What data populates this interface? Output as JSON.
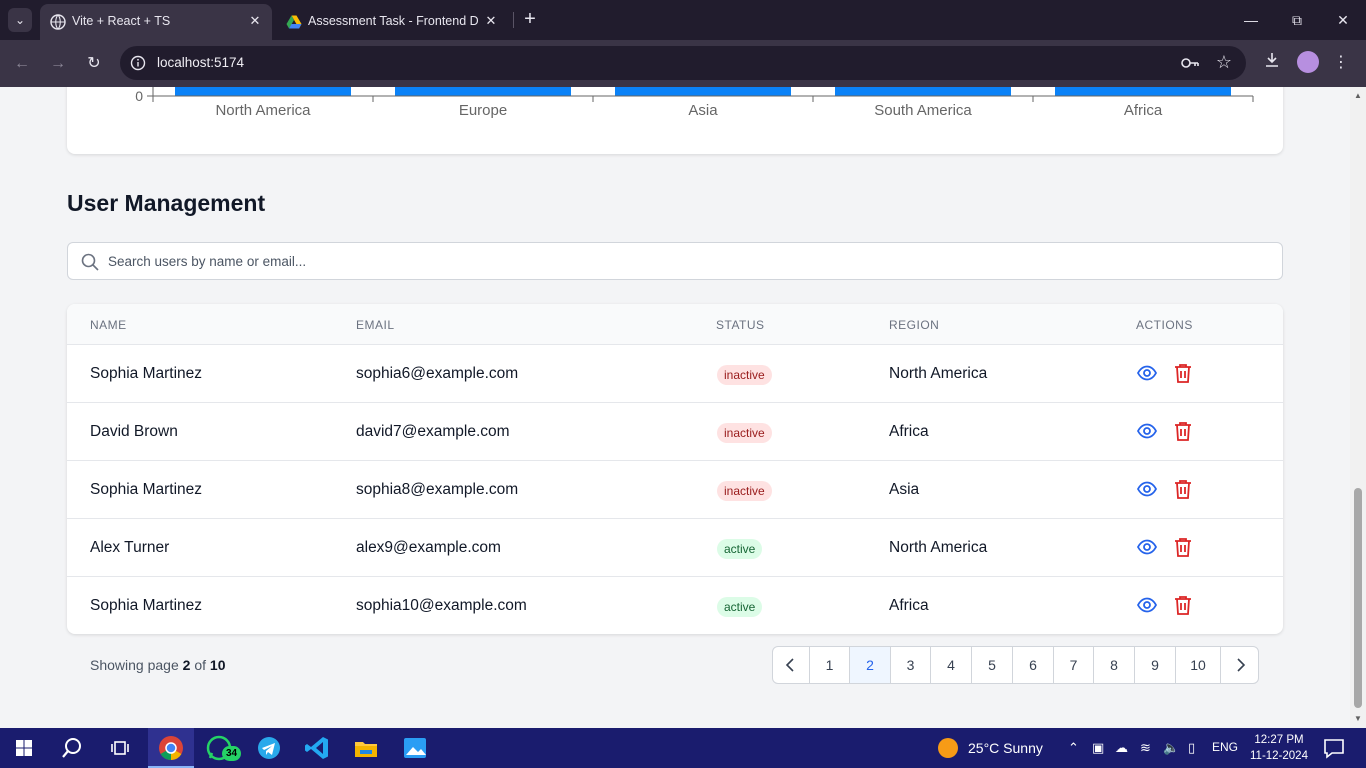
{
  "browser": {
    "tabs": [
      {
        "title": "Vite + React + TS",
        "active": true
      },
      {
        "title": "Assessment Task - Frontend Dev",
        "active": false
      }
    ],
    "url": "localhost:5174"
  },
  "chart_data": {
    "type": "bar",
    "categories": [
      "North America",
      "Europe",
      "Asia",
      "South America",
      "Africa"
    ],
    "y_tick_visible": "0"
  },
  "section": {
    "title": "User Management"
  },
  "search": {
    "placeholder": "Search users by name or email..."
  },
  "table": {
    "headers": [
      "NAME",
      "EMAIL",
      "STATUS",
      "REGION",
      "ACTIONS"
    ],
    "rows": [
      {
        "name": "Sophia Martinez",
        "email": "sophia6@example.com",
        "status": "inactive",
        "region": "North America"
      },
      {
        "name": "David Brown",
        "email": "david7@example.com",
        "status": "inactive",
        "region": "Africa"
      },
      {
        "name": "Sophia Martinez",
        "email": "sophia8@example.com",
        "status": "inactive",
        "region": "Asia"
      },
      {
        "name": "Alex Turner",
        "email": "alex9@example.com",
        "status": "active",
        "region": "North America"
      },
      {
        "name": "Sophia Martinez",
        "email": "sophia10@example.com",
        "status": "active",
        "region": "Africa"
      }
    ]
  },
  "pagination": {
    "prefix": "Showing page",
    "current": "2",
    "of": "of",
    "total": "10",
    "pages": [
      "1",
      "2",
      "3",
      "4",
      "5",
      "6",
      "7",
      "8",
      "9",
      "10"
    ]
  },
  "taskbar": {
    "whatsapp_badge": "34",
    "weather": "25°C  Sunny",
    "lang": "ENG",
    "time": "12:27 PM",
    "date": "11-12-2024"
  },
  "colors": {
    "bar": "#0b82f7",
    "primary": "#2563eb",
    "danger": "#dc2626"
  }
}
